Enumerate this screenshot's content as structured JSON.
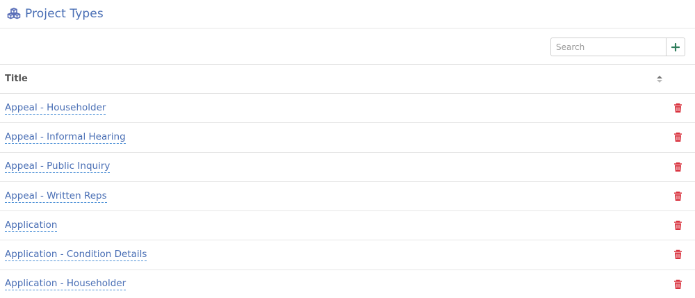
{
  "header": {
    "title": "Project Types",
    "icon": "cubes-icon",
    "accent_color": "#4a6fb5"
  },
  "toolbar": {
    "search_placeholder": "Search",
    "add_icon": "plus-icon",
    "add_color": "#2e7d5b"
  },
  "table": {
    "columns": [
      "Title"
    ],
    "sort_icon": "sort-icon",
    "delete_icon": "trash-icon",
    "delete_color": "#d9333f",
    "rows": [
      "Appeal - Householder",
      "Appeal - Informal Hearing",
      "Appeal - Public Inquiry",
      "Appeal - Written Reps",
      "Application",
      "Application - Condition Details",
      "Application - Householder"
    ]
  }
}
